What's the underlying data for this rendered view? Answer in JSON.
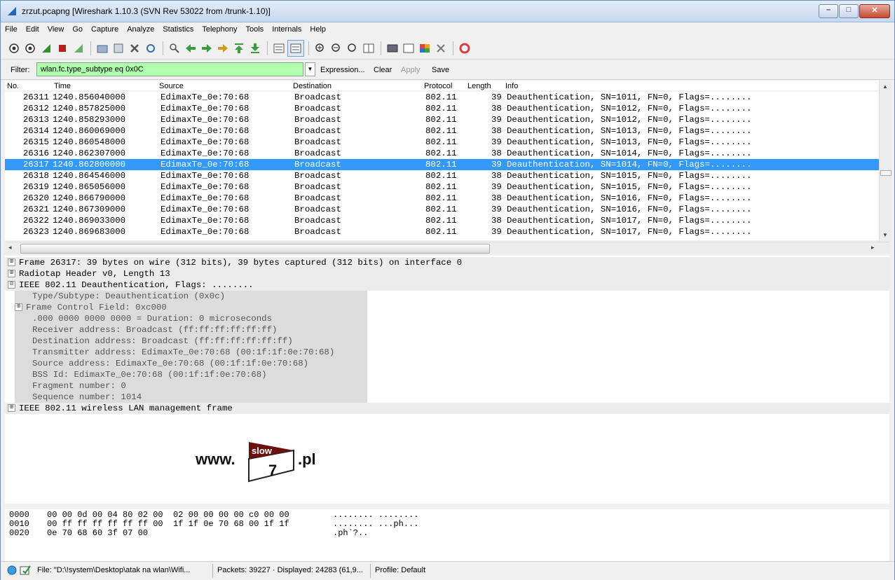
{
  "window": {
    "title": "zrzut.pcapng  [Wireshark 1.10.3  (SVN Rev 53022 from /trunk-1.10)]",
    "min_glyph": "–",
    "max_glyph": "□",
    "close_glyph": "✕"
  },
  "menu": [
    "File",
    "Edit",
    "View",
    "Go",
    "Capture",
    "Analyze",
    "Statistics",
    "Telephony",
    "Tools",
    "Internals",
    "Help"
  ],
  "toolbar_icons": [
    "interface-list-icon",
    "capture-options-icon",
    "start-capture-icon",
    "stop-capture-icon",
    "restart-capture-icon",
    "open-file-icon",
    "save-file-icon",
    "close-file-icon",
    "reload-icon",
    "find-packet-icon",
    "go-back-icon",
    "go-forward-icon",
    "go-to-packet-icon",
    "first-packet-icon",
    "last-packet-icon",
    "colorize-icon",
    "auto-scroll-icon",
    "zoom-in-icon",
    "zoom-out-icon",
    "normal-size-icon",
    "resize-columns-icon",
    "capture-filters-icon",
    "display-filters-icon",
    "coloring-rules-icon",
    "preferences-icon",
    "help-icon"
  ],
  "filter": {
    "label": "Filter:",
    "value": "wlan.fc.type_subtype eq 0x0C",
    "expression": "Expression...",
    "clear": "Clear",
    "apply": "Apply",
    "save": "Save"
  },
  "packet_list": {
    "columns": [
      "No.",
      "Time",
      "Source",
      "Destination",
      "Protocol",
      "Length",
      "Info"
    ],
    "rows": [
      {
        "no": "26311",
        "time": "1240.856040000",
        "src": "EdimaxTe_0e:70:68",
        "dst": "Broadcast",
        "proto": "802.11",
        "len": "39",
        "info": "Deauthentication, SN=1011, FN=0, Flags=........"
      },
      {
        "no": "26312",
        "time": "1240.857825000",
        "src": "EdimaxTe_0e:70:68",
        "dst": "Broadcast",
        "proto": "802.11",
        "len": "38",
        "info": "Deauthentication, SN=1012, FN=0, Flags=........"
      },
      {
        "no": "26313",
        "time": "1240.858293000",
        "src": "EdimaxTe_0e:70:68",
        "dst": "Broadcast",
        "proto": "802.11",
        "len": "39",
        "info": "Deauthentication, SN=1012, FN=0, Flags=........"
      },
      {
        "no": "26314",
        "time": "1240.860069000",
        "src": "EdimaxTe_0e:70:68",
        "dst": "Broadcast",
        "proto": "802.11",
        "len": "38",
        "info": "Deauthentication, SN=1013, FN=0, Flags=........"
      },
      {
        "no": "26315",
        "time": "1240.860548000",
        "src": "EdimaxTe_0e:70:68",
        "dst": "Broadcast",
        "proto": "802.11",
        "len": "39",
        "info": "Deauthentication, SN=1013, FN=0, Flags=........"
      },
      {
        "no": "26316",
        "time": "1240.862307000",
        "src": "EdimaxTe_0e:70:68",
        "dst": "Broadcast",
        "proto": "802.11",
        "len": "38",
        "info": "Deauthentication, SN=1014, FN=0, Flags=........"
      },
      {
        "no": "26317",
        "time": "1240.862800000",
        "src": "EdimaxTe_0e:70:68",
        "dst": "Broadcast",
        "proto": "802.11",
        "len": "39",
        "info": "Deauthentication, SN=1014, FN=0, Flags=........"
      },
      {
        "no": "26318",
        "time": "1240.864546000",
        "src": "EdimaxTe_0e:70:68",
        "dst": "Broadcast",
        "proto": "802.11",
        "len": "38",
        "info": "Deauthentication, SN=1015, FN=0, Flags=........"
      },
      {
        "no": "26319",
        "time": "1240.865056000",
        "src": "EdimaxTe_0e:70:68",
        "dst": "Broadcast",
        "proto": "802.11",
        "len": "39",
        "info": "Deauthentication, SN=1015, FN=0, Flags=........"
      },
      {
        "no": "26320",
        "time": "1240.866790000",
        "src": "EdimaxTe_0e:70:68",
        "dst": "Broadcast",
        "proto": "802.11",
        "len": "38",
        "info": "Deauthentication, SN=1016, FN=0, Flags=........"
      },
      {
        "no": "26321",
        "time": "1240.867309000",
        "src": "EdimaxTe_0e:70:68",
        "dst": "Broadcast",
        "proto": "802.11",
        "len": "39",
        "info": "Deauthentication, SN=1016, FN=0, Flags=........"
      },
      {
        "no": "26322",
        "time": "1240.869033000",
        "src": "EdimaxTe_0e:70:68",
        "dst": "Broadcast",
        "proto": "802.11",
        "len": "38",
        "info": "Deauthentication, SN=1017, FN=0, Flags=........"
      },
      {
        "no": "26323",
        "time": "1240.869683000",
        "src": "EdimaxTe_0e:70:68",
        "dst": "Broadcast",
        "proto": "802.11",
        "len": "39",
        "info": "Deauthentication, SN=1017, FN=0, Flags=........"
      }
    ],
    "selected_no": "26317"
  },
  "detail": {
    "frame": "Frame 26317: 39 bytes on wire (312 bits), 39 bytes captured (312 bits) on interface 0",
    "radiotap": "Radiotap Header v0, Length 13",
    "ieee": "IEEE 802.11 Deauthentication, Flags: ........",
    "ieee_fields": [
      "Type/Subtype: Deauthentication (0x0c)",
      "Frame Control Field: 0xc000",
      ".000 0000 0000 0000 = Duration: 0 microseconds",
      "Receiver address: Broadcast (ff:ff:ff:ff:ff:ff)",
      "Destination address: Broadcast (ff:ff:ff:ff:ff:ff)",
      "Transmitter address: EdimaxTe_0e:70:68 (00:1f:1f:0e:70:68)",
      "Source address: EdimaxTe_0e:70:68 (00:1f:1f:0e:70:68)",
      "BSS Id: EdimaxTe_0e:70:68 (00:1f:1f:0e:70:68)",
      "Fragment number: 0",
      "Sequence number: 1014"
    ],
    "mgmt": "IEEE 802.11 wireless LAN management frame",
    "expand_glyph": "⊞",
    "collapse_glyph": "⊟"
  },
  "watermark": {
    "prefix": "www.",
    "badge_top": "slow",
    "badge_num": "7",
    "suffix": ".pl"
  },
  "hex": {
    "lines": [
      {
        "offset": "0000",
        "bytes": "00 00 0d 00 04 80 02 00  02 00 00 00 00 c0 00 00",
        "ascii": "........ ........"
      },
      {
        "offset": "0010",
        "bytes": "00 ff ff ff ff ff ff 00  1f 1f 0e 70 68 00 1f 1f",
        "ascii": "........ ...ph..."
      },
      {
        "offset": "0020",
        "bytes": "0e 70 68 60 3f 07 00",
        "ascii": ".ph`?.."
      }
    ]
  },
  "status": {
    "file": "File: \"D:\\!system\\Desktop\\atak na wlan\\Wifi...",
    "packets": "Packets: 39227 · Displayed: 24283 (61,9...",
    "profile": "Profile: Default"
  },
  "colors": {
    "selected_row": "#3399ff",
    "filter_ok": "#afffaf"
  }
}
